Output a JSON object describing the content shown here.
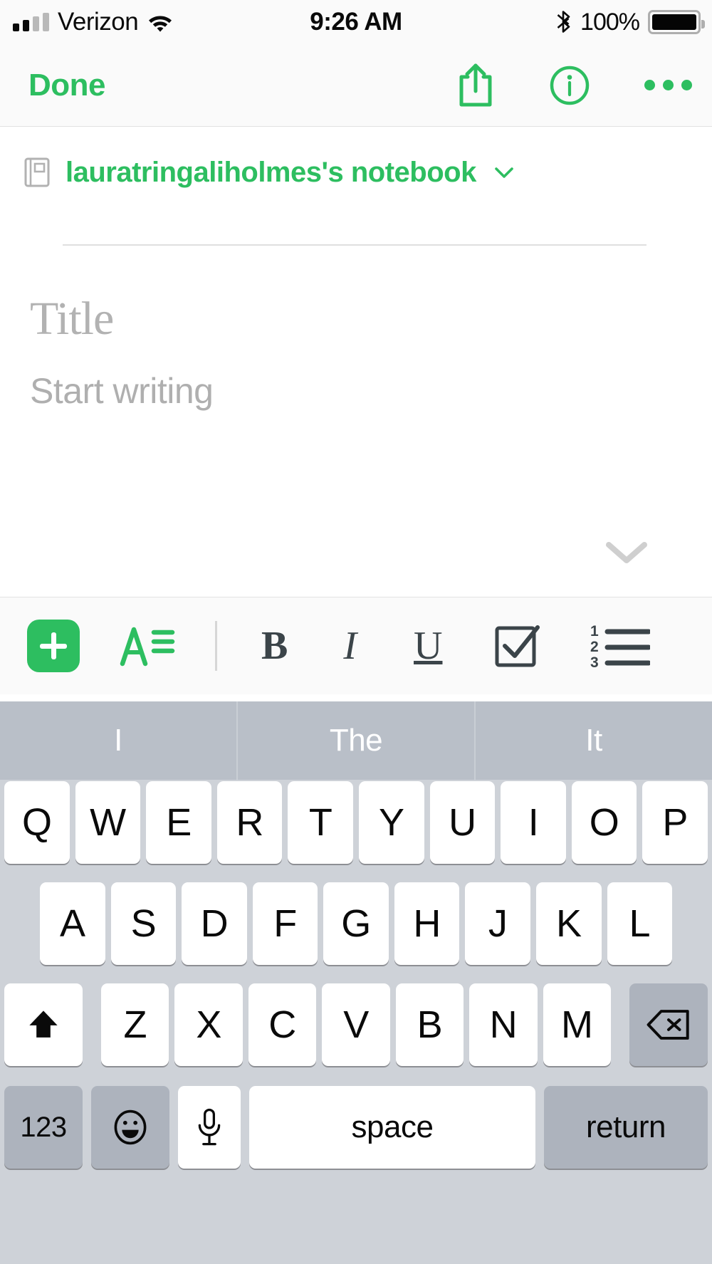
{
  "status_bar": {
    "carrier": "Verizon",
    "time": "9:26 AM",
    "battery_percent": "100%",
    "signal_bars_filled": 2,
    "signal_bars_total": 4,
    "wifi_icon": "wifi-icon",
    "bluetooth_icon": "bluetooth-icon",
    "battery_icon": "battery-full-icon"
  },
  "nav_bar": {
    "done_label": "Done",
    "share_icon": "share-icon",
    "info_icon": "info-icon",
    "more_icon": "more-options-icon"
  },
  "notebook": {
    "name": "lauratringaliholmes's notebook",
    "book_icon": "notebook-icon",
    "chevron_icon": "chevron-down-icon"
  },
  "editor": {
    "title_placeholder": "Title",
    "title_value": "",
    "body_placeholder": "Start writing",
    "body_value": "",
    "dismiss_icon": "chevron-down-icon"
  },
  "format_toolbar": {
    "add_label": "+",
    "add_icon": "plus-icon",
    "text_style_icon": "text-style-icon",
    "bold_label": "B",
    "italic_label": "I",
    "underline_label": "U",
    "checkbox_icon": "checkbox-checked-icon",
    "numbered_list_icon": "numbered-list-icon"
  },
  "predictive_bar": {
    "suggestions": [
      "I",
      "The",
      "It"
    ]
  },
  "keyboard": {
    "row1": [
      "Q",
      "W",
      "E",
      "R",
      "T",
      "Y",
      "U",
      "I",
      "O",
      "P"
    ],
    "row2": [
      "A",
      "S",
      "D",
      "F",
      "G",
      "H",
      "J",
      "K",
      "L"
    ],
    "row3_letters": [
      "Z",
      "X",
      "C",
      "V",
      "B",
      "N",
      "M"
    ],
    "shift_icon": "shift-icon",
    "backspace_icon": "backspace-icon",
    "numbers_label": "123",
    "emoji_icon": "emoji-icon",
    "dictation_icon": "microphone-icon",
    "space_label": "space",
    "return_label": "return"
  },
  "colors": {
    "accent_green": "#2DBE60",
    "keyboard_bg": "#CED2D8",
    "predictive_bg": "#B9BFC8",
    "key_dark": "#ADB3BD"
  }
}
